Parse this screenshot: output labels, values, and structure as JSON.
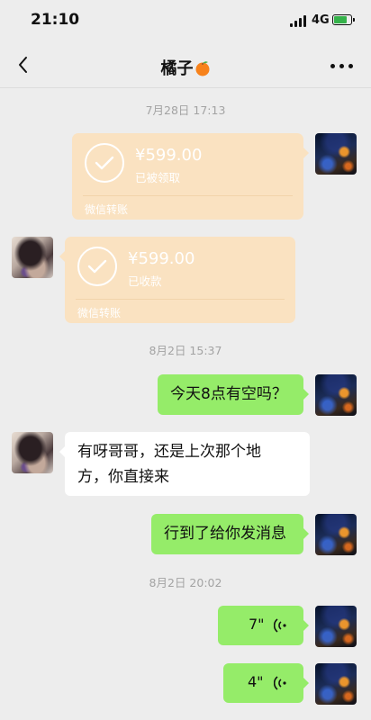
{
  "status_bar": {
    "time": "21:10",
    "network": "4G"
  },
  "nav": {
    "title": "橘子"
  },
  "messages": {
    "ts1": "7月28日 17:13",
    "transfer1": {
      "amount": "¥599.00",
      "status": "已被领取",
      "footer": "微信转账"
    },
    "transfer2": {
      "amount": "¥599.00",
      "status": "已收款",
      "footer": "微信转账"
    },
    "ts2": "8月2日 15:37",
    "msg1": "今天8点有空吗？",
    "msg2_line1": "有呀哥哥，还是上次那个地",
    "msg2_line2": "方，你直接来",
    "msg3": "行到了给你发消息",
    "ts3": "8月2日 20:02",
    "voice1": "7\"",
    "voice2": "4\""
  },
  "colors": {
    "background": "#ededed",
    "sent_bubble": "#95ec69",
    "received_bubble": "#ffffff",
    "transfer_card": "#fae2c1"
  }
}
